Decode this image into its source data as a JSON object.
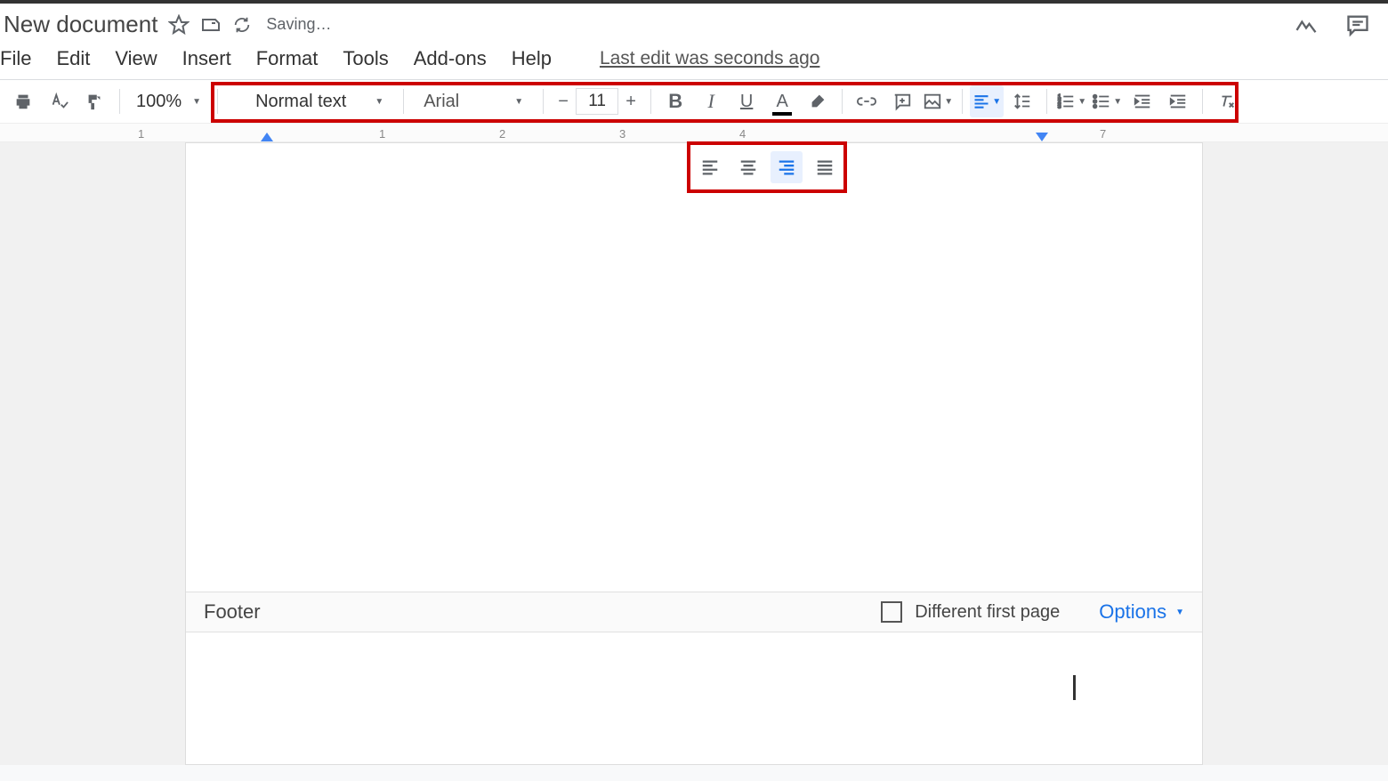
{
  "doc_title": "New document",
  "saving_status": "Saving…",
  "menubar": [
    "File",
    "Edit",
    "View",
    "Insert",
    "Format",
    "Tools",
    "Add-ons",
    "Help"
  ],
  "last_edit": "Last edit was seconds ago",
  "zoom": "100%",
  "style_select": "Normal text",
  "font_select": "Arial",
  "font_size": "11",
  "ruler_numbers": [
    "1",
    "1",
    "2",
    "3",
    "4",
    "7"
  ],
  "footer": {
    "label": "Footer",
    "diff_first": "Different first page",
    "options": "Options"
  },
  "align_popup_active": "right"
}
